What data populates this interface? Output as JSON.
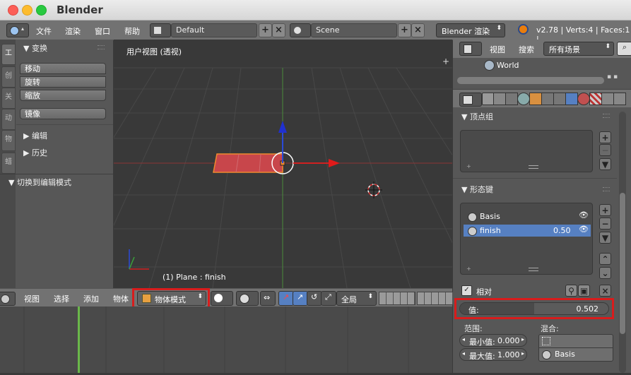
{
  "window": {
    "title": "Blender"
  },
  "info_header": {
    "menus": [
      "文件",
      "渲染",
      "窗口",
      "帮助"
    ],
    "screen_layout": "Default",
    "scene": "Scene",
    "render_engine": "Blender 渲染",
    "stats": "v2.78 | Verts:4 | Faces:1 |"
  },
  "tool_shelf": {
    "tabs": [
      "工",
      "创",
      "关",
      "动",
      "物",
      "蜡"
    ],
    "transform_panel": {
      "title": "变换",
      "buttons": [
        "移动",
        "旋转",
        "缩放"
      ],
      "mirror": "镜像"
    },
    "edit_panel": "编辑",
    "history_panel": "历史",
    "operator_panel": "切换到编辑模式"
  },
  "viewport": {
    "view_label": "用户视图 (透视)",
    "object_info": "(1) Plane : finish"
  },
  "viewport_header": {
    "menus": [
      "视图",
      "选择",
      "添加",
      "物体"
    ],
    "mode": "物体模式",
    "orientation": "全局"
  },
  "outliner": {
    "menus": [
      "视图",
      "搜索"
    ],
    "filter": "所有场景",
    "items": [
      "World"
    ]
  },
  "properties": {
    "vertex_groups_title": "顶点组",
    "shape_keys_title": "形态键",
    "shape_keys": [
      {
        "name": "Basis",
        "value": ""
      },
      {
        "name": "finish",
        "value": "0.50"
      }
    ],
    "relative_label": "相对",
    "value_label": "值:",
    "value": "0.502",
    "value_fraction": 0.502,
    "range_label": "范围:",
    "min_label": "最小值:",
    "min_value": "0.000",
    "max_label": "最大值:",
    "max_value": "1.000",
    "blend_label": "混合:",
    "blend_value": "Basis"
  },
  "colors": {
    "accent_red": "#d81c1c",
    "selection_blue": "#5680c2",
    "plane_red": "#c8464b",
    "timeline_green": "#6ab84a"
  }
}
